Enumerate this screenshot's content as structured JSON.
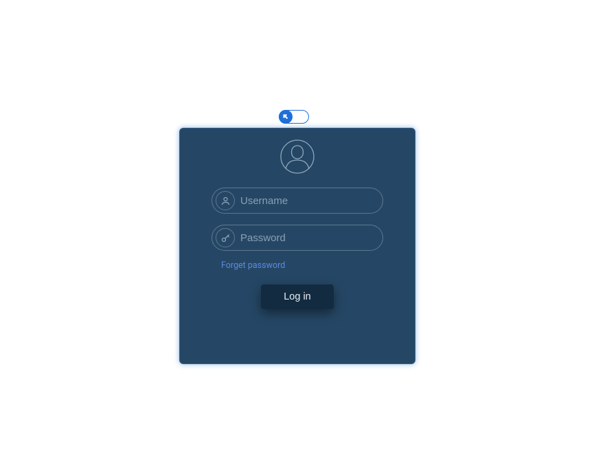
{
  "toggle": {
    "state": "left"
  },
  "login": {
    "username_placeholder": "Username",
    "username_value": "",
    "password_placeholder": "Password",
    "password_value": "",
    "forget_label": "Forget password",
    "submit_label": "Log in"
  },
  "icons": {
    "avatar": "avatar-silhouette-icon",
    "user": "user-icon",
    "key": "key-icon",
    "arrow": "arrow-up-left-icon"
  }
}
